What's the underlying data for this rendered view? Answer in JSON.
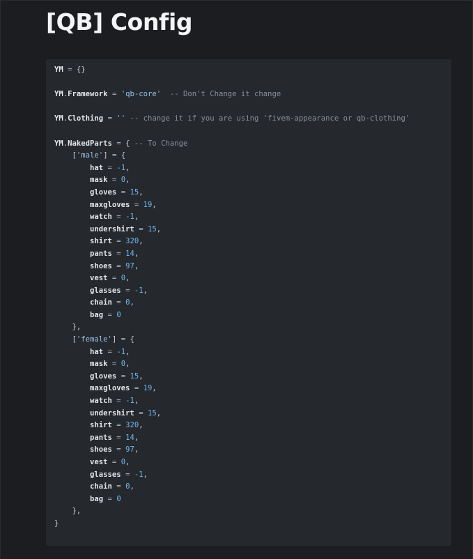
{
  "page": {
    "title": "[QB] Config"
  },
  "code": {
    "l1": {
      "var": "YM",
      "op": " = ",
      "val": "{}"
    },
    "l2": {
      "obj": "YM",
      "dot": ".",
      "key": "Framework",
      "op": " = ",
      "str": "'qb-core'",
      "comment": "  -- Don't Change it change"
    },
    "l3": {
      "obj": "YM",
      "dot": ".",
      "key": "Clothing",
      "op": " = ",
      "str": "''",
      "comment": " -- change it if you are using 'fivem-appearance or qb-clothing'"
    },
    "l4": {
      "obj": "YM",
      "dot": ".",
      "key": "NakedParts",
      "op": " = ",
      "brace": "{",
      "comment": " -- To Change"
    },
    "male_open": {
      "indent": "    ",
      "lb": "[",
      "str": "'male'",
      "rb": "]",
      "op": " = ",
      "brace": "{"
    },
    "male_items": [
      {
        "indent": "        ",
        "key": "hat",
        "op": " = ",
        "val": "-1",
        "sep": ","
      },
      {
        "indent": "        ",
        "key": "mask",
        "op": " = ",
        "val": "0",
        "sep": ","
      },
      {
        "indent": "        ",
        "key": "gloves",
        "op": " = ",
        "val": "15",
        "sep": ","
      },
      {
        "indent": "        ",
        "key": "maxgloves",
        "op": " = ",
        "val": "19",
        "sep": ","
      },
      {
        "indent": "        ",
        "key": "watch",
        "op": " = ",
        "val": "-1",
        "sep": ","
      },
      {
        "indent": "        ",
        "key": "undershirt",
        "op": " = ",
        "val": "15",
        "sep": ","
      },
      {
        "indent": "        ",
        "key": "shirt",
        "op": " = ",
        "val": "320",
        "sep": ","
      },
      {
        "indent": "        ",
        "key": "pants",
        "op": " = ",
        "val": "14",
        "sep": ","
      },
      {
        "indent": "        ",
        "key": "shoes",
        "op": " = ",
        "val": "97",
        "sep": ","
      },
      {
        "indent": "        ",
        "key": "vest",
        "op": " = ",
        "val": "0",
        "sep": ","
      },
      {
        "indent": "        ",
        "key": "glasses",
        "op": " = ",
        "val": "-1",
        "sep": ","
      },
      {
        "indent": "        ",
        "key": "chain",
        "op": " = ",
        "val": "0",
        "sep": ","
      },
      {
        "indent": "        ",
        "key": "bag",
        "op": " = ",
        "val": "0",
        "sep": ""
      }
    ],
    "male_close": {
      "indent": "    ",
      "text": "},"
    },
    "female_open": {
      "indent": "    ",
      "lb": "[",
      "str": "'female'",
      "rb": "]",
      "op": " = ",
      "brace": "{"
    },
    "female_items": [
      {
        "indent": "        ",
        "key": "hat",
        "op": " = ",
        "val": "-1",
        "sep": ","
      },
      {
        "indent": "        ",
        "key": "mask",
        "op": " = ",
        "val": "0",
        "sep": ","
      },
      {
        "indent": "        ",
        "key": "gloves",
        "op": " = ",
        "val": "15",
        "sep": ","
      },
      {
        "indent": "        ",
        "key": "maxgloves",
        "op": " = ",
        "val": "19",
        "sep": ","
      },
      {
        "indent": "        ",
        "key": "watch",
        "op": " = ",
        "val": "-1",
        "sep": ","
      },
      {
        "indent": "        ",
        "key": "undershirt",
        "op": " = ",
        "val": "15",
        "sep": ","
      },
      {
        "indent": "        ",
        "key": "shirt",
        "op": " = ",
        "val": "320",
        "sep": ","
      },
      {
        "indent": "        ",
        "key": "pants",
        "op": " = ",
        "val": "14",
        "sep": ","
      },
      {
        "indent": "        ",
        "key": "shoes",
        "op": " = ",
        "val": "97",
        "sep": ","
      },
      {
        "indent": "        ",
        "key": "vest",
        "op": " = ",
        "val": "0",
        "sep": ","
      },
      {
        "indent": "        ",
        "key": "glasses",
        "op": " = ",
        "val": "-1",
        "sep": ","
      },
      {
        "indent": "        ",
        "key": "chain",
        "op": " = ",
        "val": "0",
        "sep": ","
      },
      {
        "indent": "        ",
        "key": "bag",
        "op": " = ",
        "val": "0",
        "sep": ""
      }
    ],
    "female_close": {
      "indent": "    ",
      "text": "},"
    },
    "end": {
      "text": "}"
    }
  },
  "colors": {
    "background": "#1b1d20",
    "code_background": "#25282c",
    "title": "#f2f4f6",
    "string": "#98c2ea",
    "number": "#72b8f2",
    "comment": "#8a9099"
  }
}
